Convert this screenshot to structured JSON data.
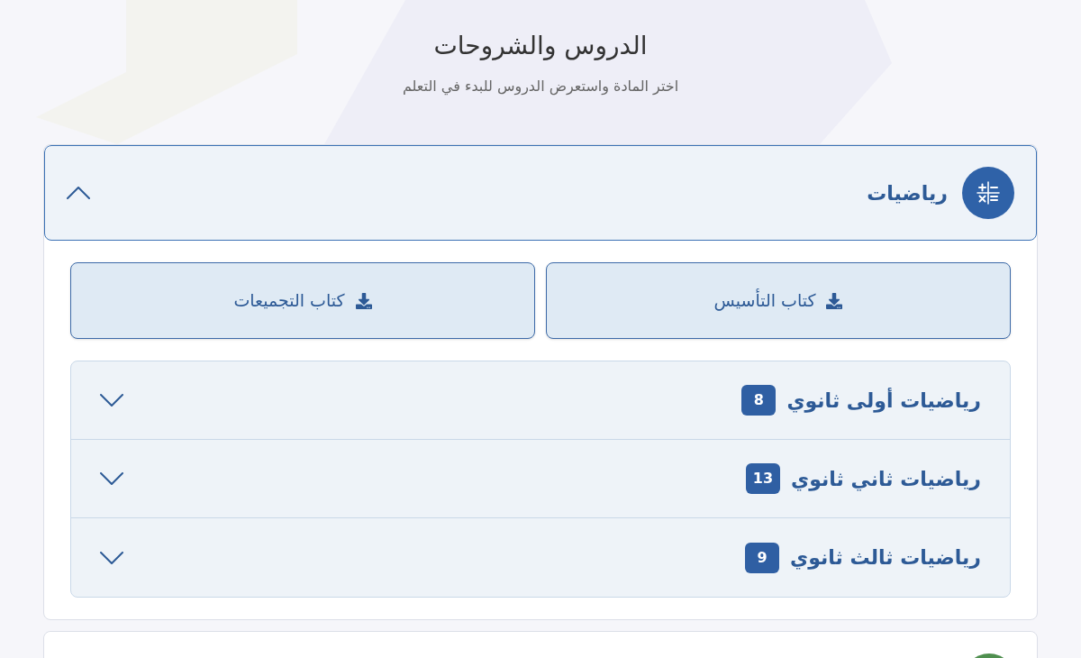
{
  "page": {
    "title": "الدروس والشروحات",
    "subtitle": "اختر المادة واستعرض الدروس للبدء في التعلم"
  },
  "subjects": [
    {
      "name": "رياضيات",
      "expanded": true,
      "color": "#2f62a8",
      "books": [
        {
          "label": "كتاب التأسيس"
        },
        {
          "label": "كتاب التجميعات"
        }
      ],
      "grades": [
        {
          "name": "رياضيات أولى ثانوي",
          "count": "8",
          "expanded": false
        },
        {
          "name": "رياضيات ثاني ثانوي",
          "count": "13",
          "expanded": false
        },
        {
          "name": "رياضيات ثالث ثانوي",
          "count": "9",
          "expanded": false
        }
      ]
    },
    {
      "expanded": false,
      "color": "#4f8f4f"
    }
  ]
}
